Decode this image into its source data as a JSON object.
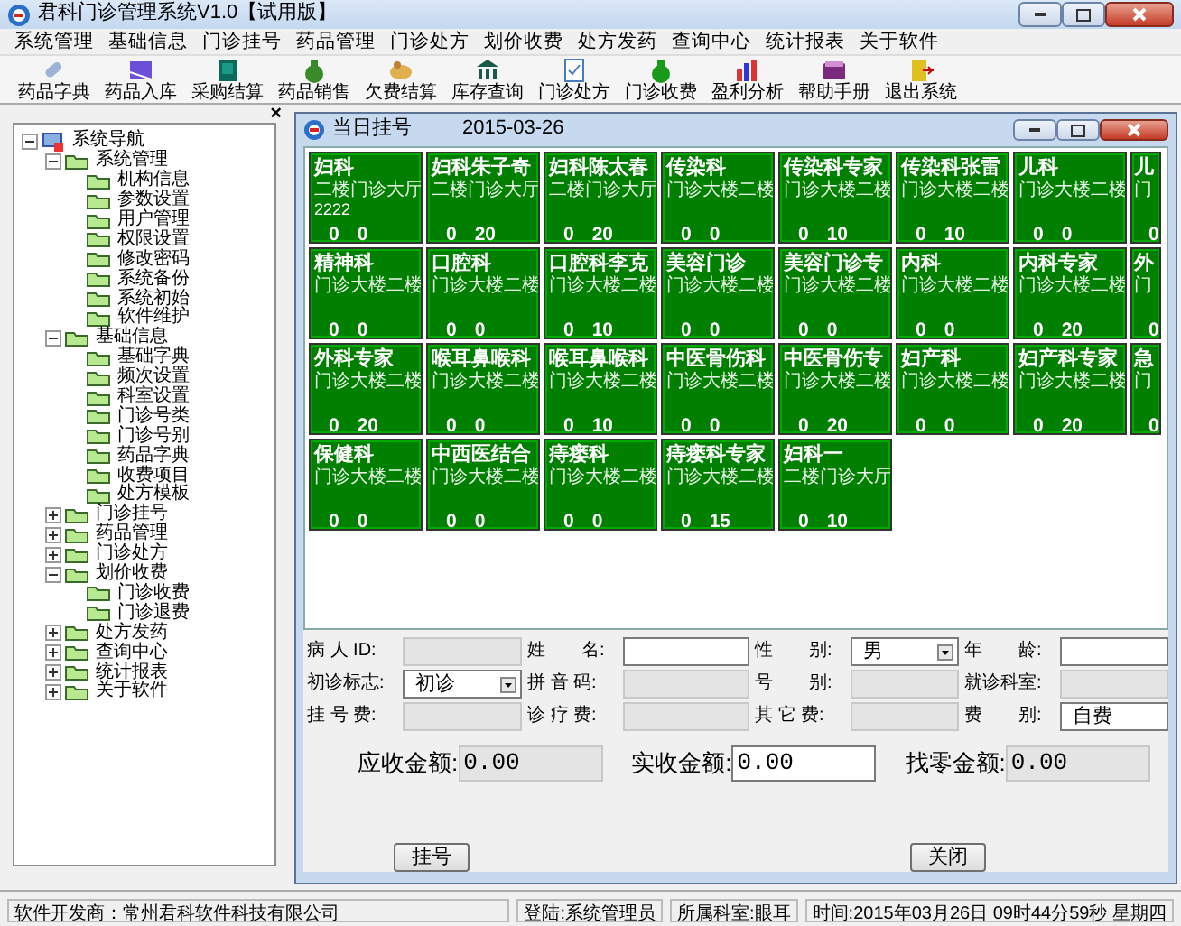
{
  "window": {
    "title": "君科门诊管理系统V1.0【试用版】"
  },
  "menu": [
    "系统管理",
    "基础信息",
    "门诊挂号",
    "药品管理",
    "门诊处方",
    "划价收费",
    "处方发药",
    "查询中心",
    "统计报表",
    "关于软件"
  ],
  "toolbar": [
    "药品字典",
    "药品入库",
    "采购结算",
    "药品销售",
    "欠费结算",
    "库存查询",
    "门诊处方",
    "门诊收费",
    "盈利分析",
    "帮助手册",
    "退出系统"
  ],
  "navigation": {
    "close": "×",
    "tree": [
      {
        "label": "系统导航",
        "expanded": true,
        "children": [
          {
            "label": "系统管理",
            "expanded": true,
            "children": [
              {
                "label": "机构信息"
              },
              {
                "label": "参数设置"
              },
              {
                "label": "用户管理"
              },
              {
                "label": "权限设置"
              },
              {
                "label": "修改密码"
              },
              {
                "label": "系统备份"
              },
              {
                "label": "系统初始"
              },
              {
                "label": "软件维护"
              }
            ]
          },
          {
            "label": "基础信息",
            "expanded": true,
            "children": [
              {
                "label": "基础字典"
              },
              {
                "label": "频次设置"
              },
              {
                "label": "科室设置"
              },
              {
                "label": "门诊号类"
              },
              {
                "label": "门诊号别"
              },
              {
                "label": "药品字典"
              },
              {
                "label": "收费项目"
              },
              {
                "label": "处方模板"
              }
            ]
          },
          {
            "label": "门诊挂号",
            "expanded": false
          },
          {
            "label": "药品管理",
            "expanded": false
          },
          {
            "label": "门诊处方",
            "expanded": false
          },
          {
            "label": "划价收费",
            "expanded": true,
            "children": [
              {
                "label": "门诊收费"
              },
              {
                "label": "门诊退费"
              }
            ]
          },
          {
            "label": "处方发药",
            "expanded": false
          },
          {
            "label": "查询中心",
            "expanded": false
          },
          {
            "label": "统计报表",
            "expanded": false
          },
          {
            "label": "关于软件",
            "expanded": false
          }
        ]
      }
    ]
  },
  "registration_window": {
    "title": "当日挂号",
    "date": "2015-03-26",
    "clinics": [
      {
        "name": "妇科",
        "location": "二楼门诊大厅",
        "note": "2222",
        "count_1": "0",
        "count_2": "0"
      },
      {
        "name": "妇科朱子奇",
        "location": "二楼门诊大厅",
        "count_1": "0",
        "count_2": "20"
      },
      {
        "name": "妇科陈太春",
        "location": "二楼门诊大厅",
        "count_1": "0",
        "count_2": "20"
      },
      {
        "name": "传染科",
        "location": "门诊大楼二楼",
        "count_1": "0",
        "count_2": "0"
      },
      {
        "name": "传染科专家",
        "location": "门诊大楼二楼",
        "count_1": "0",
        "count_2": "10"
      },
      {
        "name": "传染科张雷",
        "location": "门诊大楼二楼",
        "count_1": "0",
        "count_2": "10"
      },
      {
        "name": "儿科",
        "location": "门诊大楼二楼",
        "count_1": "0",
        "count_2": "0"
      },
      {
        "name": "儿",
        "location": "门",
        "count_1": "0",
        "partial": true
      },
      {
        "name": "精神科",
        "location": "门诊大楼二楼",
        "count_1": "0",
        "count_2": "0"
      },
      {
        "name": "口腔科",
        "location": "门诊大楼二楼",
        "count_1": "0",
        "count_2": "0"
      },
      {
        "name": "口腔科李克",
        "location": "门诊大楼二楼",
        "count_1": "0",
        "count_2": "10"
      },
      {
        "name": "美容门诊",
        "location": "门诊大楼二楼",
        "count_1": "0",
        "count_2": "0"
      },
      {
        "name": "美容门诊专",
        "location": "门诊大楼二楼",
        "count_1": "0",
        "count_2": "0"
      },
      {
        "name": "内科",
        "location": "门诊大楼二楼",
        "count_1": "0",
        "count_2": "0"
      },
      {
        "name": "内科专家",
        "location": "门诊大楼二楼",
        "count_1": "0",
        "count_2": "20"
      },
      {
        "name": "外",
        "location": "门",
        "count_1": "0",
        "partial": true
      },
      {
        "name": "外科专家",
        "location": "门诊大楼二楼",
        "count_1": "0",
        "count_2": "20"
      },
      {
        "name": "喉耳鼻喉科",
        "location": "门诊大楼二楼",
        "count_1": "0",
        "count_2": "0"
      },
      {
        "name": "喉耳鼻喉科",
        "location": "门诊大楼二楼",
        "count_1": "0",
        "count_2": "10"
      },
      {
        "name": "中医骨伤科",
        "location": "门诊大楼二楼",
        "count_1": "0",
        "count_2": "0"
      },
      {
        "name": "中医骨伤专",
        "location": "门诊大楼二楼",
        "count_1": "0",
        "count_2": "20"
      },
      {
        "name": "妇产科",
        "location": "门诊大楼二楼",
        "count_1": "0",
        "count_2": "0"
      },
      {
        "name": "妇产科专家",
        "location": "门诊大楼二楼",
        "count_1": "0",
        "count_2": "20"
      },
      {
        "name": "急",
        "location": "门",
        "count_1": "0",
        "partial": true
      },
      {
        "name": "保健科",
        "location": "门诊大楼二楼",
        "count_1": "0",
        "count_2": "0"
      },
      {
        "name": "中西医结合",
        "location": "门诊大楼二楼",
        "count_1": "0",
        "count_2": "0"
      },
      {
        "name": "痔瘘科",
        "location": "门诊大楼二楼",
        "count_1": "0",
        "count_2": "0"
      },
      {
        "name": "痔瘘科专家",
        "location": "门诊大楼二楼",
        "count_1": "0",
        "count_2": "15"
      },
      {
        "name": "妇科一",
        "location": "二楼门诊大厅",
        "count_1": "0",
        "count_2": "10"
      }
    ],
    "form": {
      "fields": [
        {
          "label": "病 人 ID:",
          "kind": "text",
          "readonly": true
        },
        {
          "label": "姓　　名:",
          "kind": "text",
          "readonly": false
        },
        {
          "label": "性　　别:",
          "kind": "select",
          "readonly": false,
          "value": "男"
        },
        {
          "label": "年　　龄:",
          "kind": "text",
          "readonly": false
        },
        {
          "label": "初诊标志:",
          "kind": "select",
          "readonly": false,
          "value": "初诊"
        },
        {
          "label": "拼 音 码:",
          "kind": "text",
          "readonly": true
        },
        {
          "label": "号　　别:",
          "kind": "text",
          "readonly": true
        },
        {
          "label": "就诊科室:",
          "kind": "text",
          "readonly": true
        },
        {
          "label": "挂 号 费:",
          "kind": "text",
          "readonly": true
        },
        {
          "label": "诊 疗 费:",
          "kind": "text",
          "readonly": true
        },
        {
          "label": "其 它 费:",
          "kind": "text",
          "readonly": true
        },
        {
          "label": "费　　别:",
          "kind": "text",
          "readonly": false,
          "value": "自费"
        }
      ],
      "amounts": [
        {
          "label": "应收金额:",
          "value": "0.00",
          "readonly": true
        },
        {
          "label": "实收金额:",
          "value": "0.00",
          "readonly": false
        },
        {
          "label": "找零金额:",
          "value": "0.00",
          "readonly": true
        }
      ],
      "buttons": [
        "挂号",
        "关闭"
      ]
    }
  },
  "status_bar": [
    "软件开发商：常州君科软件科技有限公司",
    "登陆:系统管理员",
    "所属科室:眼耳",
    "时间:2015年03月26日 09时44分59秒 星期四"
  ]
}
